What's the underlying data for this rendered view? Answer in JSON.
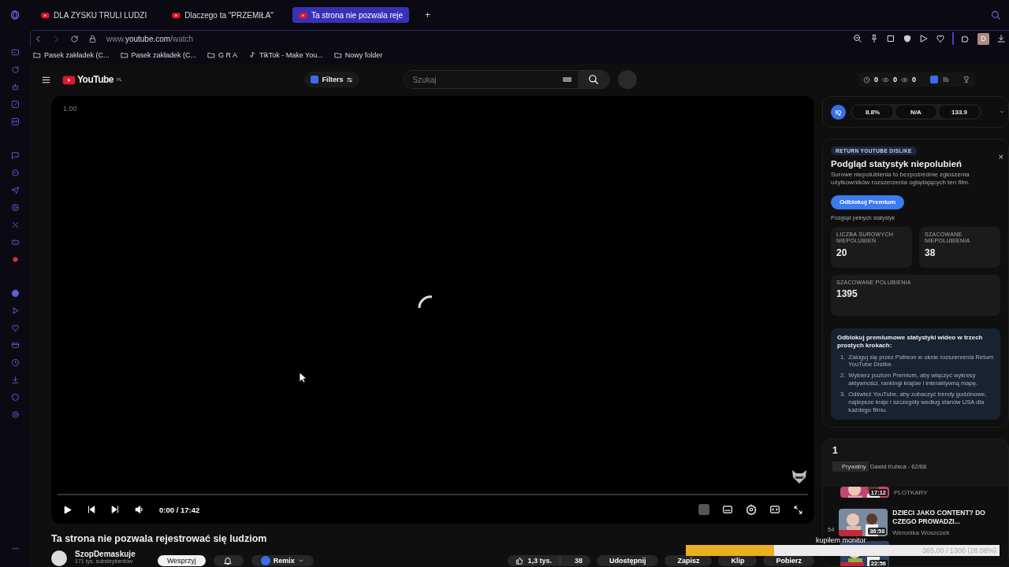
{
  "browser": {
    "tabs": [
      {
        "title": "DLA ZYSKU TRULI LUDZI",
        "selected": false
      },
      {
        "title": "Dlaczego ta \"PRZEMIŁA\"",
        "selected": false
      },
      {
        "title": "Ta strona nie pozwala reje",
        "selected": true
      }
    ],
    "new_tab": "+",
    "url": {
      "prefix": "www.",
      "domain": "youtube.com",
      "path": "/watch"
    },
    "bookmarks": [
      {
        "label": "Pasek zakładek (C...",
        "kind": "folder"
      },
      {
        "label": "Pasek zakładek (C...",
        "kind": "folder"
      },
      {
        "label": "G R A",
        "kind": "folder"
      },
      {
        "label": "TikTok - Make You...",
        "kind": "tiktok"
      },
      {
        "label": "Nowy folder",
        "kind": "folder"
      }
    ],
    "profile_initial": "D"
  },
  "header": {
    "logo": "YouTube",
    "region": "PL",
    "filters": "Filters",
    "search": {
      "placeholder": "Szukaj"
    },
    "counters": [
      "0",
      "0",
      "0"
    ]
  },
  "player": {
    "speed": "1.00",
    "time": "0:00 / 17:42"
  },
  "video": {
    "title": "Ta strona nie pozwala rejestrować się ludziom",
    "channel": "SzopDemaskuje",
    "subscribers": "171 tys. subskrybentów",
    "support": "Wesprzyj",
    "remix": "Remix",
    "likes": "1,3 tys.",
    "dislikes": "38",
    "actions": [
      "Udostępnij",
      "Zapisz",
      "Klip",
      "Pobierz"
    ]
  },
  "iq_bar": {
    "badge": "IQ",
    "values": [
      "8.8%",
      "N/A",
      "133.9"
    ]
  },
  "dislike_panel": {
    "badge": "RETURN YOUTUBE DISLIKE",
    "close": "×",
    "title": "Podgląd statystyk niepolubień",
    "description": "Surowe niepolubienia to bezpośrednie zgłoszenia użytkowników rozszerzenia oglądających ten film.",
    "button": "Odblokuj Premium",
    "note": "Podgląd pełnych statystyk",
    "stats": [
      {
        "label": "LICZBA SUROWYCH NIEPOLUBIEŃ",
        "value": "20"
      },
      {
        "label": "SZACOWANE NIEPOLUBIENIA",
        "value": "38"
      },
      {
        "label": "SZACOWANE POLUBIENIA",
        "value": "1395"
      }
    ],
    "premium": {
      "title": "Odblokuj premiumowe statystyki wideo w trzech prostych krokach:",
      "steps": [
        {
          "number": "1.",
          "text": "Zaloguj się przez Patreon w oknie rozszerzenia Return YouTube Dislike."
        },
        {
          "number": "2.",
          "text": "Wybierz poziom Premium, aby włączyć wykresy aktywności, rankingi krajów i interaktywną mapę."
        },
        {
          "number": "3.",
          "text": "Odśwież YouTube, aby zobaczyć trendy godzinowe, najlepsze kraje i szczegóły według stanów USA dla każdego filmu."
        }
      ]
    }
  },
  "playlist": {
    "title": "1",
    "privacy": "Prywatny",
    "owner": "Dawid Kubica - 62/68",
    "items": [
      {
        "kind": "partial",
        "duration": "17:12",
        "channel": "PLOTKARY"
      },
      {
        "kind": "full",
        "index": "54",
        "duration": "36:58",
        "title": "DZIECI JAKO CONTENT? DO CZEGO PROWADZI...",
        "channel": "Weronika Woszczek"
      },
      {
        "kind": "covered",
        "duration": "22:56"
      }
    ]
  },
  "goal_overlay": {
    "label": "kupiłem monitor",
    "level": 0.2808,
    "reading": "365.00 / 1300 (28.08%)"
  }
}
